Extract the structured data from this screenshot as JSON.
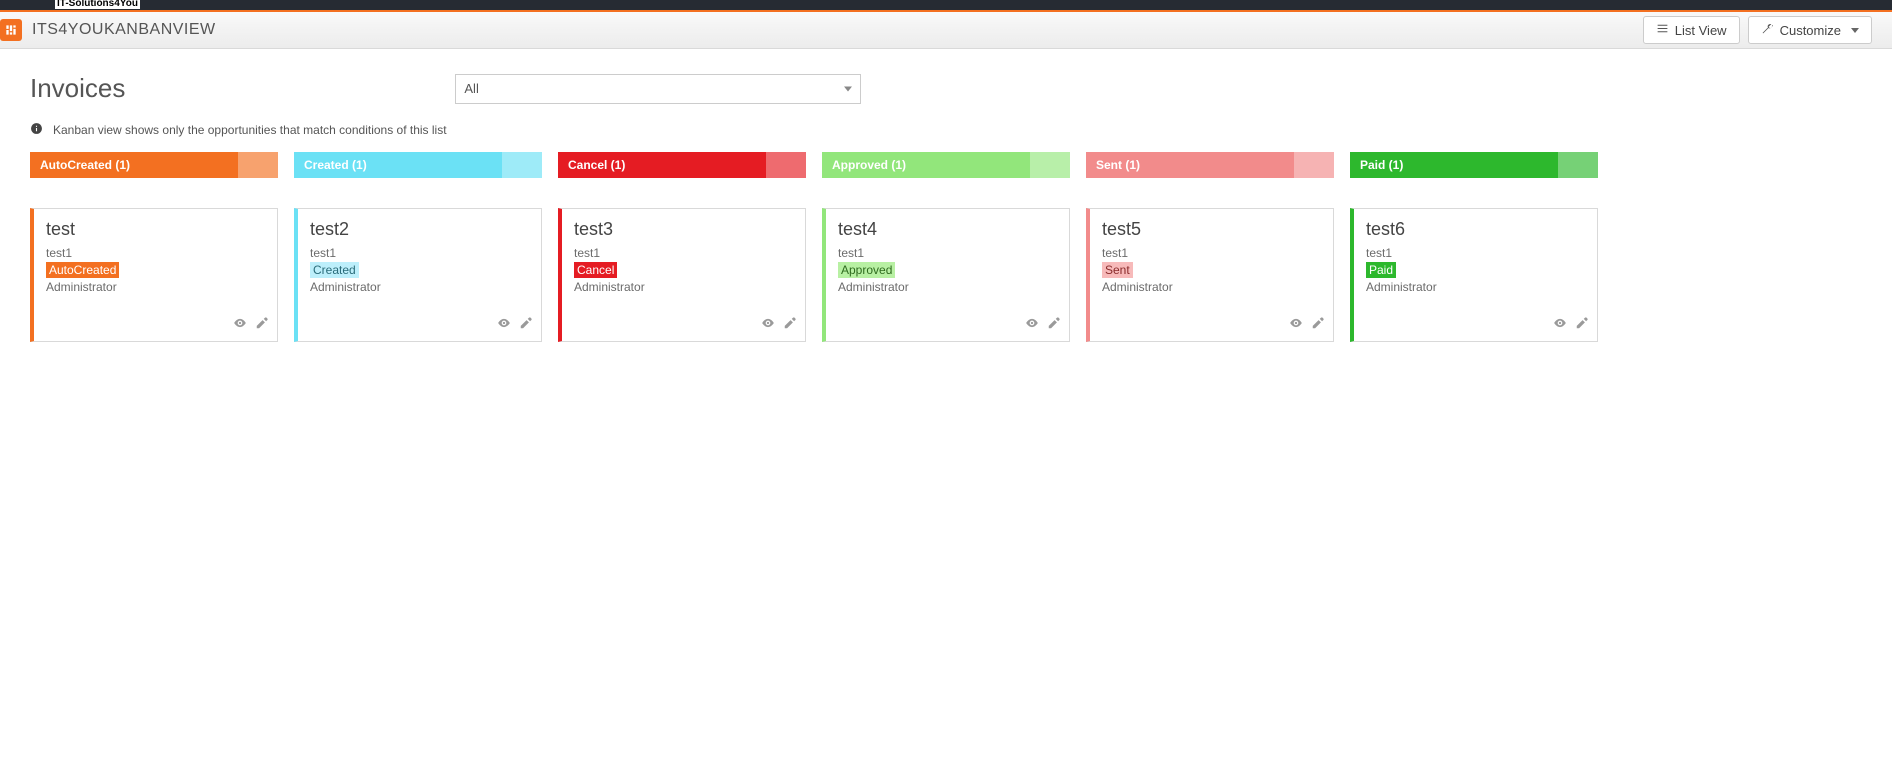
{
  "top": {
    "brand": "IT-Solutions4You"
  },
  "module": {
    "title": "ITS4YOUKANBANVIEW",
    "list_view_label": "List View",
    "customize_label": "Customize"
  },
  "page": {
    "title": "Invoices",
    "filter_selected": "All",
    "info_text": "Kanban view shows only the opportunities that match conditions of this list"
  },
  "columns": [
    {
      "key": "autocreated",
      "header": "AutoCreated (1)",
      "color_class": "orange",
      "card": {
        "title": "test",
        "sub": "test1",
        "badge": "AutoCreated",
        "owner": "Administrator"
      }
    },
    {
      "key": "created",
      "header": "Created (1)",
      "color_class": "cyan",
      "card": {
        "title": "test2",
        "sub": "test1",
        "badge": "Created",
        "owner": "Administrator"
      }
    },
    {
      "key": "cancel",
      "header": "Cancel (1)",
      "color_class": "red",
      "card": {
        "title": "test3",
        "sub": "test1",
        "badge": "Cancel",
        "owner": "Administrator"
      }
    },
    {
      "key": "approved",
      "header": "Approved (1)",
      "color_class": "lightgreen",
      "card": {
        "title": "test4",
        "sub": "test1",
        "badge": "Approved",
        "owner": "Administrator"
      }
    },
    {
      "key": "sent",
      "header": "Sent (1)",
      "color_class": "salmon",
      "card": {
        "title": "test5",
        "sub": "test1",
        "badge": "Sent",
        "owner": "Administrator"
      }
    },
    {
      "key": "paid",
      "header": "Paid (1)",
      "color_class": "green",
      "card": {
        "title": "test6",
        "sub": "test1",
        "badge": "Paid",
        "owner": "Administrator"
      }
    }
  ]
}
